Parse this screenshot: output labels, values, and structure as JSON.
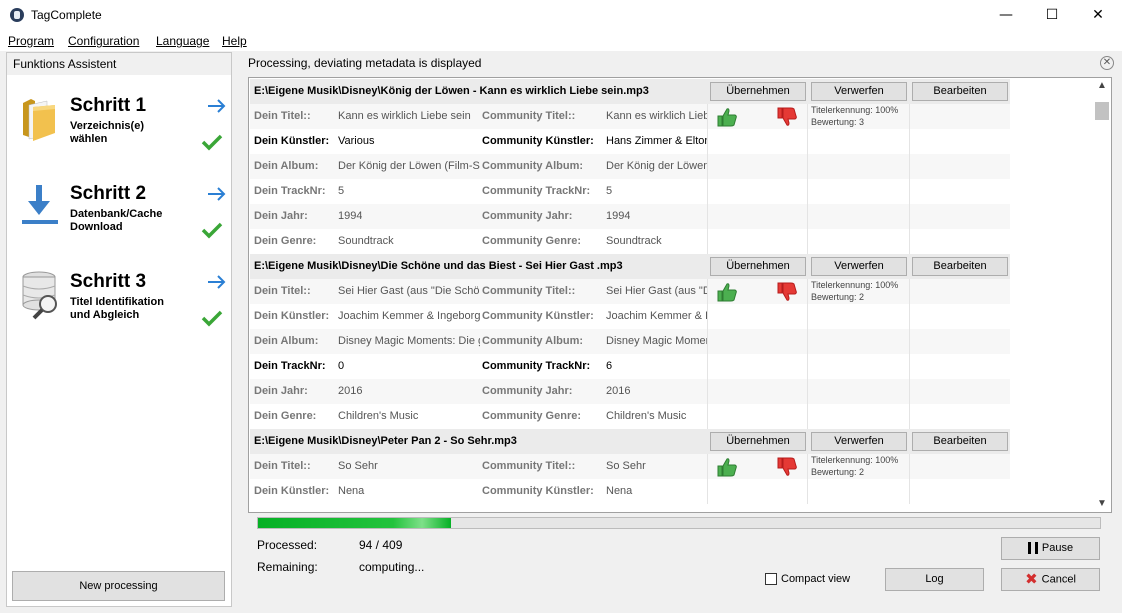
{
  "window": {
    "title": "TagComplete",
    "minimize": "—",
    "maximize": "☐",
    "close": "✕"
  },
  "menu": [
    "Program",
    "Configuration",
    "Language",
    "Help"
  ],
  "left": {
    "header": "Funktions Assistent",
    "steps": [
      {
        "title": "Schritt 1",
        "sub1": "Verzeichnis(e)",
        "sub2": "wählen",
        "icon": "folder-icon"
      },
      {
        "title": "Schritt 2",
        "sub1": "Datenbank/Cache",
        "sub2": "Download",
        "icon": "download-icon"
      },
      {
        "title": "Schritt 3",
        "sub1": "Titel Identifikation",
        "sub2": "und Abgleich",
        "icon": "database-search-icon"
      }
    ],
    "new_processing": "New processing"
  },
  "main": {
    "header": "Processing, deviating metadata is displayed",
    "buttons": {
      "accept": "Übernehmen",
      "discard": "Verwerfen",
      "edit": "Bearbeiten"
    },
    "labels": {
      "your_title": "Dein Titel::",
      "your_artist": "Dein Künstler:",
      "your_album": "Dein Album:",
      "your_track": "Dein TrackNr:",
      "your_year": "Dein Jahr:",
      "your_genre": "Dein Genre:",
      "comm_title": "Community Titel::",
      "comm_artist": "Community Künstler:",
      "comm_album": "Community Album:",
      "comm_track": "Community TrackNr:",
      "comm_year": "Community Jahr:",
      "comm_genre": "Community Genre:"
    },
    "files": [
      {
        "path": "E:\\Eigene Musik\\Disney\\König der Löwen - Kann es wirklich Liebe sein.mp3",
        "title": "Kann es wirklich Liebe sein",
        "c_title": "Kann es wirklich Liebe",
        "artist": "Various",
        "c_artist": "Hans Zimmer & Elton",
        "album": "Der König der Löwen (Film-Sou",
        "c_album": "Der König der Löwen",
        "track": "5",
        "c_track": "5",
        "year": "1994",
        "c_year": "1994",
        "genre": "Soundtrack",
        "c_genre": "Soundtrack",
        "ident": "Titelerkennung: 100%",
        "rating": "Bewertung: 3"
      },
      {
        "path": "E:\\Eigene Musik\\Disney\\Die Schöne und das Biest - Sei Hier Gast .mp3",
        "title": "Sei Hier Gast (aus \"Die Schöne",
        "c_title": "Sei Hier Gast (aus \"Di",
        "artist": "Joachim Kemmer & Ingeborg W",
        "c_artist": "Joachim Kemmer & In",
        "album": "Disney Magic Moments: Die gr",
        "c_album": "Disney Magic Moment",
        "track": "0",
        "c_track": "6",
        "year": "2016",
        "c_year": "2016",
        "genre": "Children's Music",
        "c_genre": "Children's Music",
        "ident": "Titelerkennung: 100%",
        "rating": "Bewertung: 2"
      },
      {
        "path": "E:\\Eigene Musik\\Disney\\Peter Pan 2 - So Sehr.mp3",
        "title": "So Sehr",
        "c_title": "So Sehr",
        "artist": "Nena",
        "c_artist": "Nena",
        "ident": "Titelerkennung: 100%",
        "rating": "Bewertung: 2"
      }
    ]
  },
  "status": {
    "progress_fraction": 0.2298,
    "processed_label": "Processed:",
    "processed_value": "94 / 409",
    "remaining_label": "Remaining:",
    "remaining_value": "computing...",
    "compact_view": "Compact view",
    "pause": "Pause",
    "log": "Log",
    "cancel": "Cancel"
  }
}
